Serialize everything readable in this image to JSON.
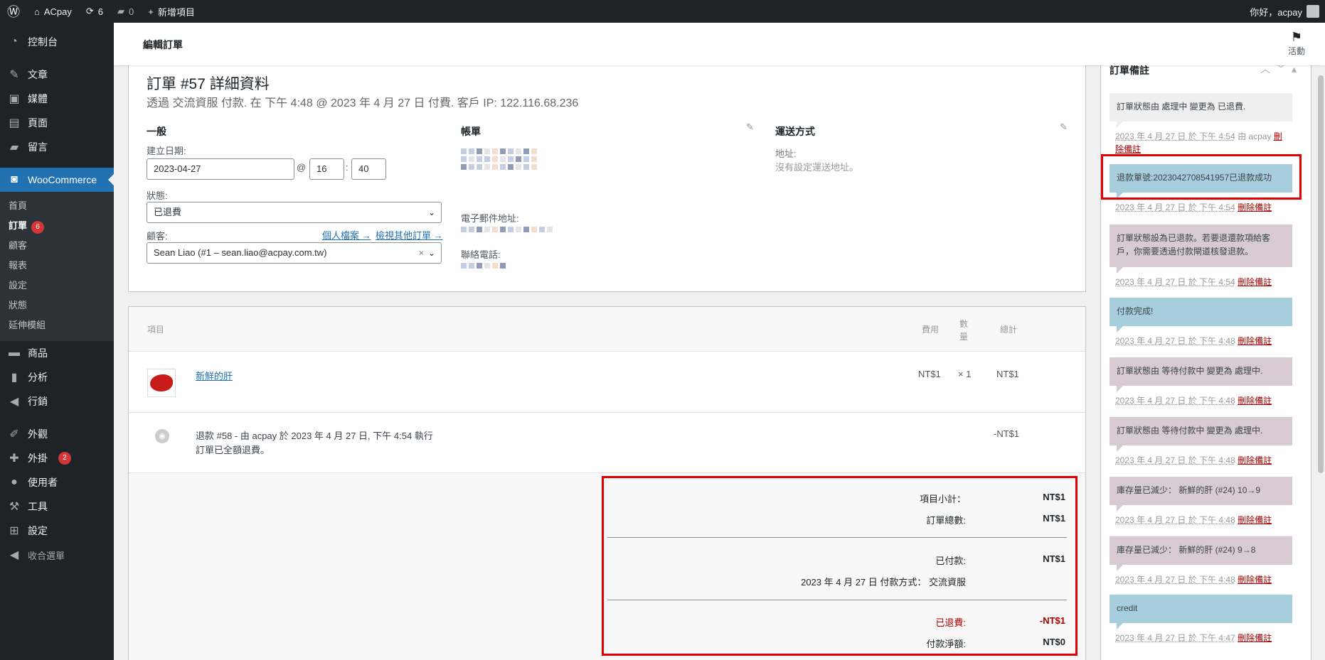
{
  "adminbar": {
    "site_name": "ACpay",
    "updates_count": "6",
    "comments_count": "0",
    "new_item_label": "新增項目",
    "greeting": "你好，acpay"
  },
  "sidebar": {
    "dashboard": "控制台",
    "posts": "文章",
    "media": "媒體",
    "pages": "頁面",
    "comments": "留言",
    "woocommerce": "WooCommerce",
    "woo_sub": {
      "home": "首頁",
      "orders": "訂單",
      "orders_badge": "6",
      "customers": "顧客",
      "reports": "報表",
      "settings": "設定",
      "status": "狀態",
      "extensions": "延伸模組"
    },
    "products": "商品",
    "analytics": "分析",
    "marketing": "行銷",
    "appearance": "外觀",
    "plugins": "外掛",
    "plugins_badge": "2",
    "users": "使用者",
    "tools": "工具",
    "settings": "設定",
    "collapse": "收合選單"
  },
  "topbar": {
    "title": "編輯訂單",
    "activity_label": "活動"
  },
  "order": {
    "heading": "訂單 #57 詳細資料",
    "subheading": "透過 交流資服 付款. 在 下午 4:48 @ 2023 年 4 月 27 日 付費. 客戶 IP: 122.116.68.236",
    "general": {
      "title": "一般",
      "created_label": "建立日期:",
      "created_date": "2023-04-27",
      "at": "@",
      "hour": "16",
      "colon": ":",
      "minute": "40",
      "status_label": "狀態:",
      "status_value": "已退費",
      "customer_label": "顧客:",
      "profile_link": "個人檔案 →",
      "other_orders_link": "檢視其他訂單 →",
      "customer_value": "Sean Liao (#1 – sean.liao@acpay.com.tw)",
      "clear_x": "×"
    },
    "billing": {
      "title": "帳單",
      "email_label": "電子郵件地址:",
      "phone_label": "聯絡電話:"
    },
    "shipping": {
      "title": "運送方式",
      "address_label": "地址:",
      "address_value": "沒有設定運送地址。"
    }
  },
  "items": {
    "headers": {
      "item": "項目",
      "cost": "費用",
      "qty": "數量",
      "total": "總計"
    },
    "line": {
      "name": "新鮮的肝",
      "cost": "NT$1",
      "qty": "× 1",
      "total": "NT$1"
    },
    "refund": {
      "text": "退款 #58 - 由 acpay 於 2023 年 4 月 27 日, 下午 4:54 執行",
      "note": "訂單已全額退費。",
      "amount": "-NT$1"
    },
    "totals": {
      "subtotal_label": "項目小計：",
      "subtotal": "NT$1",
      "order_total_label": "訂單總數:",
      "order_total": "NT$1",
      "paid_label": "已付款:",
      "paid": "NT$1",
      "paid_via": "2023 年 4 月 27 日 付款方式： 交流資服",
      "refunded_label": "已退費:",
      "refunded": "-NT$1",
      "net_label": "付款淨額:",
      "net": "NT$0"
    }
  },
  "notes": {
    "title": "訂單備註",
    "list": [
      {
        "text": "訂單狀態由 處理中 變更為 已退費.",
        "date": "2023 年 4 月 27 日 於 下午 4:54",
        "by": " 由 acpay",
        "delete": "刪除備註",
        "kind": "grey"
      },
      {
        "text": "退款單號:2023042708541957已退款成功",
        "date": "2023 年 4 月 27 日 於 下午 4:54",
        "by": "",
        "delete": "刪除備註",
        "kind": "blue"
      },
      {
        "text": "訂單狀態設為已退款。若要退還款項給客戶，你需要透過付款閘道核發退款。",
        "date": "2023 年 4 月 27 日 於 下午 4:54",
        "by": "",
        "delete": "刪除備註",
        "kind": "pink"
      },
      {
        "text": "付款完成!",
        "date": "2023 年 4 月 27 日 於 下午 4:48",
        "by": "",
        "delete": "刪除備註",
        "kind": "blue"
      },
      {
        "text": "訂單狀態由 等待付款中 變更為 處理中.",
        "date": "2023 年 4 月 27 日 於 下午 4:48",
        "by": "",
        "delete": "刪除備註",
        "kind": "pink"
      },
      {
        "text": "訂單狀態由 等待付款中 變更為 處理中.",
        "date": "2023 年 4 月 27 日 於 下午 4:48",
        "by": "",
        "delete": "刪除備註",
        "kind": "pink"
      },
      {
        "text": "庫存量已減少： 新鮮的肝 (#24) 10→9",
        "date": "2023 年 4 月 27 日 於 下午 4:48",
        "by": "",
        "delete": "刪除備註",
        "kind": "pink"
      },
      {
        "text": "庫存量已減少： 新鮮的肝 (#24) 9→8",
        "date": "2023 年 4 月 27 日 於 下午 4:48",
        "by": "",
        "delete": "刪除備註",
        "kind": "pink"
      },
      {
        "text": "credit",
        "date": "2023 年 4 月 27 日 於 下午 4:47",
        "by": "",
        "delete": "刪除備註",
        "kind": "blue"
      }
    ]
  },
  "colors": {
    "highlight": "#e20000",
    "accent": "#2271b1",
    "note_blue": "#a7cedc",
    "note_pink": "#d7cad2"
  }
}
